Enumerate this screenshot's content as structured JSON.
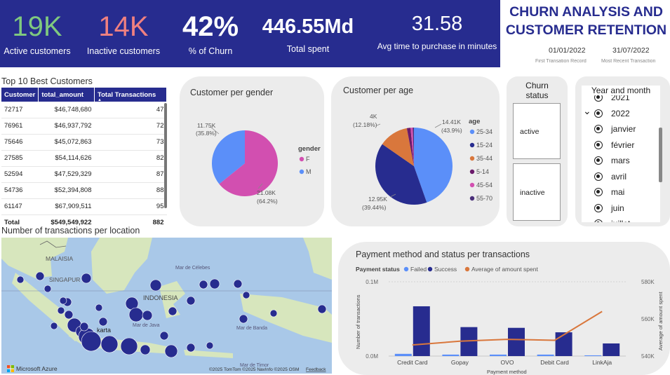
{
  "kpis": [
    {
      "value": "19K",
      "label": "Active customers",
      "color": "#7fc97f"
    },
    {
      "value": "14K",
      "label": "Inactive customers",
      "color": "#f08080"
    },
    {
      "value": "42%",
      "label": "% of Churn",
      "color": "#ffffff"
    },
    {
      "value": "446.55Md",
      "label": "Total spent",
      "color": "#ffffff"
    },
    {
      "value": "31.58",
      "label": "Avg time to purchase in minutes",
      "color": "#ffffff"
    }
  ],
  "title": {
    "line1": "CHURN ANALYSIS AND",
    "line2": "CUSTOMER RETENTION"
  },
  "dates": {
    "first_value": "01/01/2022",
    "first_label": "First Transation Record",
    "recent_value": "31/07/2022",
    "recent_label": "Most Recent Transaction"
  },
  "best_customers": {
    "title": "Top 10 Best Customers",
    "columns": [
      "Customer",
      "total_amount",
      "Total Transactions"
    ],
    "rows": [
      [
        "72717",
        "$46,748,680",
        "47"
      ],
      [
        "76961",
        "$46,937,792",
        "72"
      ],
      [
        "75646",
        "$45,072,863",
        "73"
      ],
      [
        "27585",
        "$54,114,626",
        "82"
      ],
      [
        "52594",
        "$47,529,329",
        "87"
      ],
      [
        "54736",
        "$52,394,808",
        "88"
      ],
      [
        "61147",
        "$67,909,511",
        "95"
      ]
    ],
    "total": [
      "Total",
      "$549,549,922",
      "882"
    ]
  },
  "gender_card": {
    "title": "Customer per gender",
    "legend_title": "gender",
    "labels": [
      {
        "value": "11.75K",
        "pct": "(35.8%)"
      },
      {
        "value": "21.08K",
        "pct": "(64.2%)"
      }
    ]
  },
  "age_card": {
    "title": "Customer per age",
    "legend_title": "age",
    "labels": [
      {
        "value": "4K",
        "pct": "(12.18%)"
      },
      {
        "value": "14.41K",
        "pct": "(43.9%)"
      },
      {
        "value": "12.95K",
        "pct": "(39.44%)"
      }
    ]
  },
  "churn_slicer": {
    "title_l1": "Churn",
    "title_l2": "status",
    "options": [
      "active",
      "inactive"
    ]
  },
  "date_slicer": {
    "title": "Year and month",
    "items": [
      "2021",
      "2022",
      "janvier",
      "février",
      "mars",
      "avril",
      "mai",
      "juin",
      "juillet"
    ]
  },
  "map": {
    "title": "Number of transactions per location",
    "labels": [
      "MALAISIA",
      "SINGAPUR",
      "INDONESIA",
      "karta",
      "Mar de Célebes",
      "Mar de Java",
      "Mar de Banda",
      "Mar de Timor"
    ],
    "brand": "Microsoft Azure",
    "credits": "©2025 TomTom ©2025 NavInfo ©2025 OSM",
    "feedback": "Feedback"
  },
  "payment_card": {
    "title": "Payment method and status per transactions",
    "legend_title": "Payment status",
    "xlabel": "Payment method",
    "ylabel_left": "Number of transactions",
    "ylabel_right": "Average of amount spent"
  },
  "chart_data": [
    {
      "type": "pie",
      "title": "Customer per gender",
      "legend_title": "gender",
      "categories": [
        "F",
        "M"
      ],
      "values": [
        21080,
        11750
      ],
      "colors": [
        "#d24fb0",
        "#5b8ff9"
      ]
    },
    {
      "type": "pie",
      "title": "Customer per age",
      "legend_title": "age",
      "categories": [
        "25-34",
        "15-24",
        "35-44",
        "5-14",
        "45-54",
        "55-70"
      ],
      "values": [
        14410,
        12950,
        4000,
        500,
        300,
        150
      ],
      "colors": [
        "#5b8ff9",
        "#272c8f",
        "#d9773c",
        "#6b1a6b",
        "#d24fb0",
        "#4a2f7a"
      ]
    },
    {
      "type": "bar",
      "title": "Payment method and status per transactions",
      "categories": [
        "Credit Card",
        "Gopay",
        "OVO",
        "Debit Card",
        "LinkAja"
      ],
      "xlabel": "Payment method",
      "ylabel": "Number of transactions",
      "ylim": [
        0,
        100000
      ],
      "yticks": [
        "0.0M",
        "0.1M"
      ],
      "series": [
        {
          "name": "Failed",
          "values": [
            3000,
            2000,
            2000,
            2000,
            1000
          ],
          "color": "#5b8ff9"
        },
        {
          "name": "Success",
          "values": [
            67000,
            39000,
            38000,
            32000,
            17000
          ],
          "color": "#272c8f"
        },
        {
          "name": "Average of amount spent",
          "type": "line",
          "axis": "right",
          "values": [
            546000,
            548000,
            549000,
            548500,
            564000
          ],
          "color": "#d9773c"
        }
      ],
      "y2lim": [
        540000,
        580000
      ],
      "y2ticks": [
        "540K",
        "560K",
        "580K"
      ]
    }
  ]
}
